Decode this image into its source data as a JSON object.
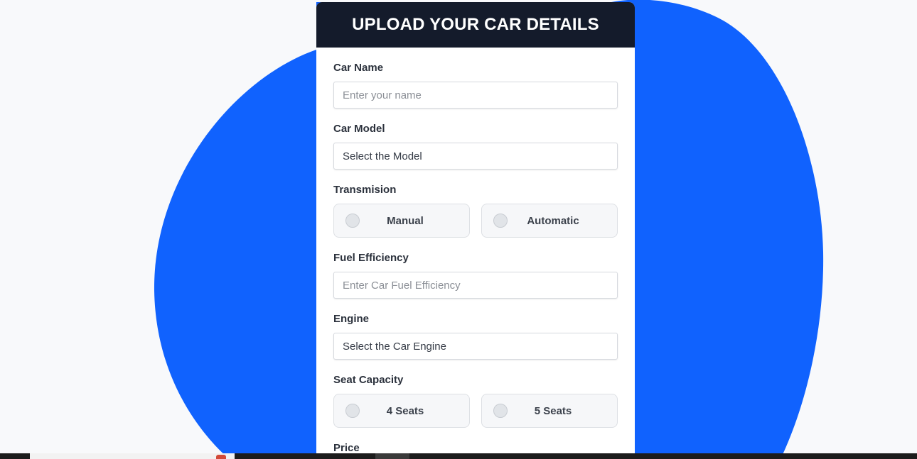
{
  "header": {
    "title": "UPLOAD YOUR CAR DETAILS"
  },
  "fields": {
    "car_name": {
      "label": "Car Name",
      "placeholder": "Enter your name"
    },
    "car_model": {
      "label": "Car Model",
      "value": "Select the Model"
    },
    "transmission": {
      "label": "Transmision",
      "options": [
        "Manual",
        "Automatic"
      ]
    },
    "fuel_efficiency": {
      "label": "Fuel Efficiency",
      "placeholder": "Enter Car Fuel Efficiency"
    },
    "engine": {
      "label": "Engine",
      "value": "Select the Car Engine"
    },
    "seat_capacity": {
      "label": "Seat Capacity",
      "options": [
        "4 Seats",
        "5 Seats"
      ]
    },
    "price": {
      "label": "Price"
    }
  },
  "colors": {
    "blob": "#1062fe",
    "header_bg": "#141b2b",
    "page_bg": "#f8f9fb"
  }
}
